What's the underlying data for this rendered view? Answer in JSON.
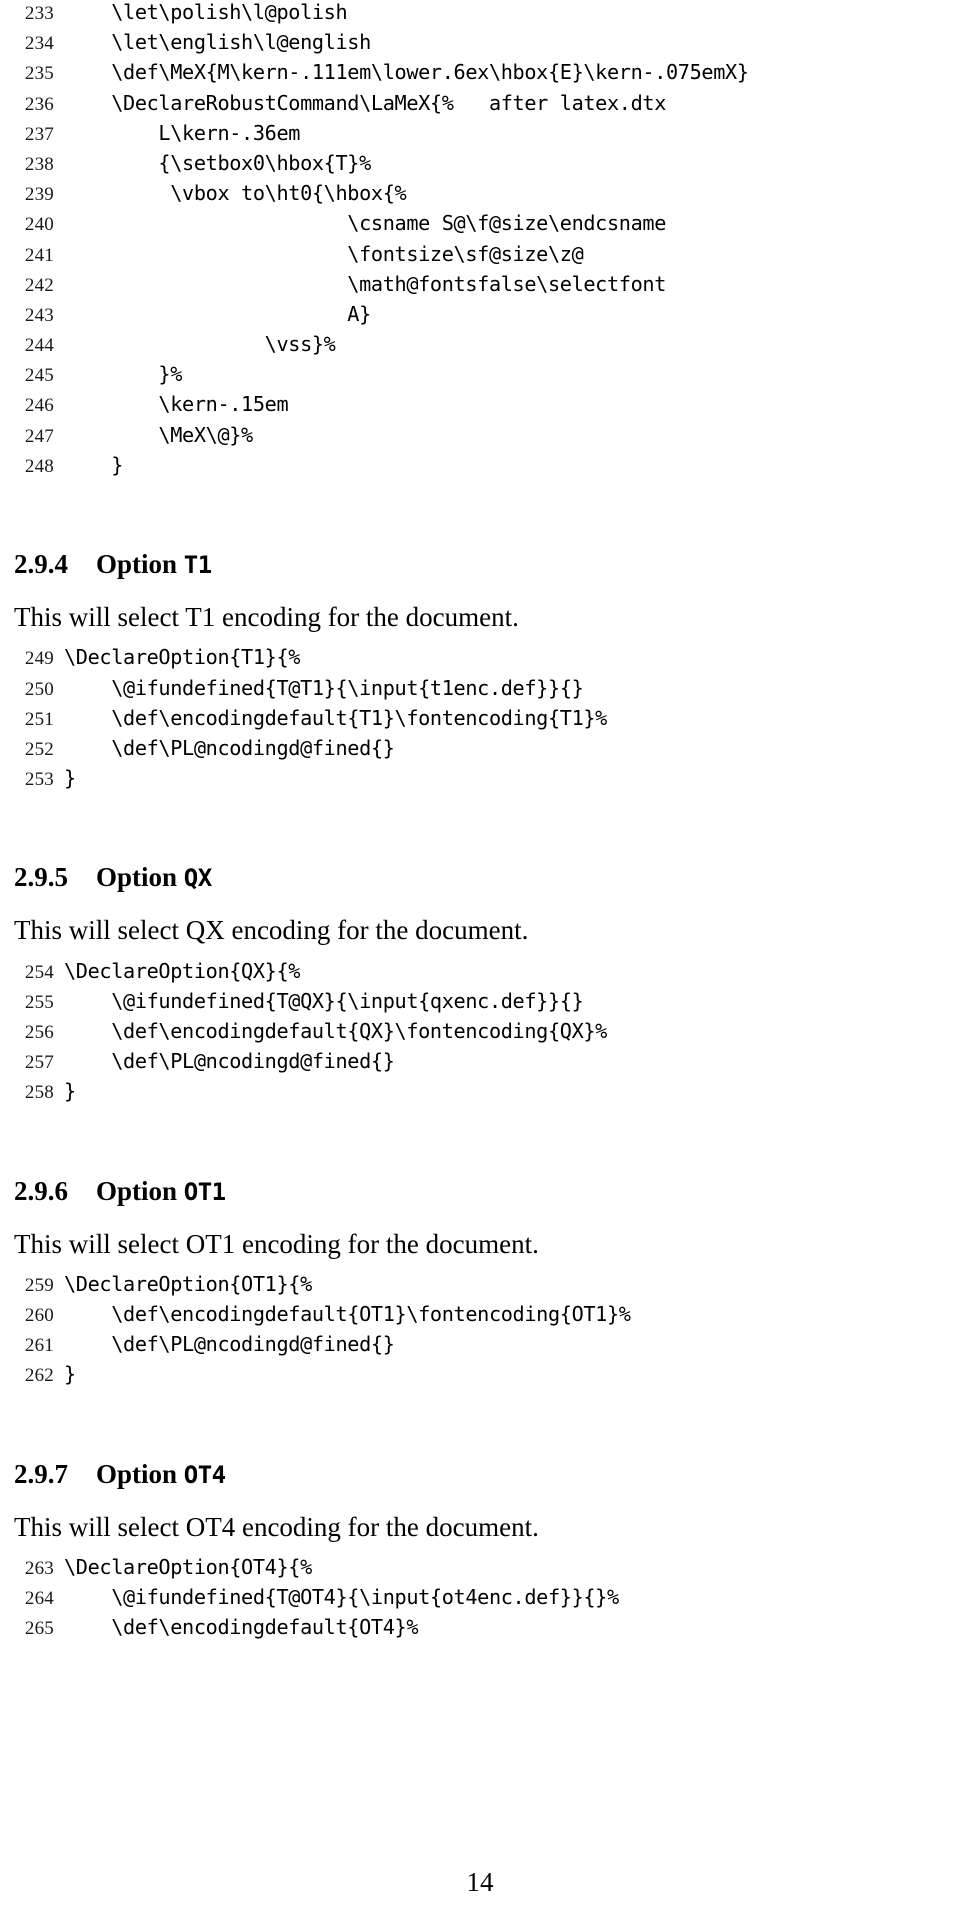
{
  "document": {
    "page_number": "14",
    "blocks": [
      {
        "kind": "listing",
        "lines": [
          {
            "no": "233",
            "text": "    \\let\\polish\\l@polish"
          },
          {
            "no": "234",
            "text": "    \\let\\english\\l@english"
          },
          {
            "no": "235",
            "text": "    \\def\\MeX{M\\kern-.111em\\lower.6ex\\hbox{E}\\kern-.075emX}"
          },
          {
            "no": "236",
            "text": "    \\DeclareRobustCommand\\LaMeX{%   after latex.dtx"
          },
          {
            "no": "237",
            "text": "        L\\kern-.36em"
          },
          {
            "no": "238",
            "text": "        {\\setbox0\\hbox{T}%"
          },
          {
            "no": "239",
            "text": "         \\vbox to\\ht0{\\hbox{%"
          },
          {
            "no": "240",
            "text": "                        \\csname S@\\f@size\\endcsname"
          },
          {
            "no": "241",
            "text": "                        \\fontsize\\sf@size\\z@"
          },
          {
            "no": "242",
            "text": "                        \\math@fontsfalse\\selectfont"
          },
          {
            "no": "243",
            "text": "                        A}"
          },
          {
            "no": "244",
            "text": "                 \\vss}%"
          },
          {
            "no": "245",
            "text": "        }%"
          },
          {
            "no": "246",
            "text": "        \\kern-.15em"
          },
          {
            "no": "247",
            "text": "        \\MeX\\@}%"
          },
          {
            "no": "248",
            "text": "    }"
          }
        ]
      },
      {
        "kind": "section",
        "number": "2.9.4",
        "title_prefix": "Option ",
        "title_mono": "T1"
      },
      {
        "kind": "paragraph",
        "text": "This will select T1 encoding for the document."
      },
      {
        "kind": "listing",
        "lines": [
          {
            "no": "249",
            "text": "\\DeclareOption{T1}{%"
          },
          {
            "no": "250",
            "text": "    \\@ifundefined{T@T1}{\\input{t1enc.def}}{}"
          },
          {
            "no": "251",
            "text": "    \\def\\encodingdefault{T1}\\fontencoding{T1}%"
          },
          {
            "no": "252",
            "text": "    \\def\\PL@ncodingd@fined{}"
          },
          {
            "no": "253",
            "text": "}"
          }
        ]
      },
      {
        "kind": "section",
        "number": "2.9.5",
        "title_prefix": "Option ",
        "title_mono": "QX"
      },
      {
        "kind": "paragraph",
        "text": "This will select QX encoding for the document."
      },
      {
        "kind": "listing",
        "lines": [
          {
            "no": "254",
            "text": "\\DeclareOption{QX}{%"
          },
          {
            "no": "255",
            "text": "    \\@ifundefined{T@QX}{\\input{qxenc.def}}{}"
          },
          {
            "no": "256",
            "text": "    \\def\\encodingdefault{QX}\\fontencoding{QX}%"
          },
          {
            "no": "257",
            "text": "    \\def\\PL@ncodingd@fined{}"
          },
          {
            "no": "258",
            "text": "}"
          }
        ]
      },
      {
        "kind": "section",
        "number": "2.9.6",
        "title_prefix": "Option ",
        "title_mono": "OT1"
      },
      {
        "kind": "paragraph",
        "text": "This will select OT1 encoding for the document."
      },
      {
        "kind": "listing",
        "lines": [
          {
            "no": "259",
            "text": "\\DeclareOption{OT1}{%"
          },
          {
            "no": "260",
            "text": "    \\def\\encodingdefault{OT1}\\fontencoding{OT1}%"
          },
          {
            "no": "261",
            "text": "    \\def\\PL@ncodingd@fined{}"
          },
          {
            "no": "262",
            "text": "}"
          }
        ]
      },
      {
        "kind": "section",
        "number": "2.9.7",
        "title_prefix": "Option ",
        "title_mono": "OT4"
      },
      {
        "kind": "paragraph",
        "text": "This will select OT4 encoding for the document."
      },
      {
        "kind": "listing",
        "lines": [
          {
            "no": "263",
            "text": "\\DeclareOption{OT4}{%"
          },
          {
            "no": "264",
            "text": "    \\@ifundefined{T@OT4}{\\input{ot4enc.def}}{}%"
          },
          {
            "no": "265",
            "text": "    \\def\\encodingdefault{OT4}%"
          }
        ]
      }
    ]
  }
}
